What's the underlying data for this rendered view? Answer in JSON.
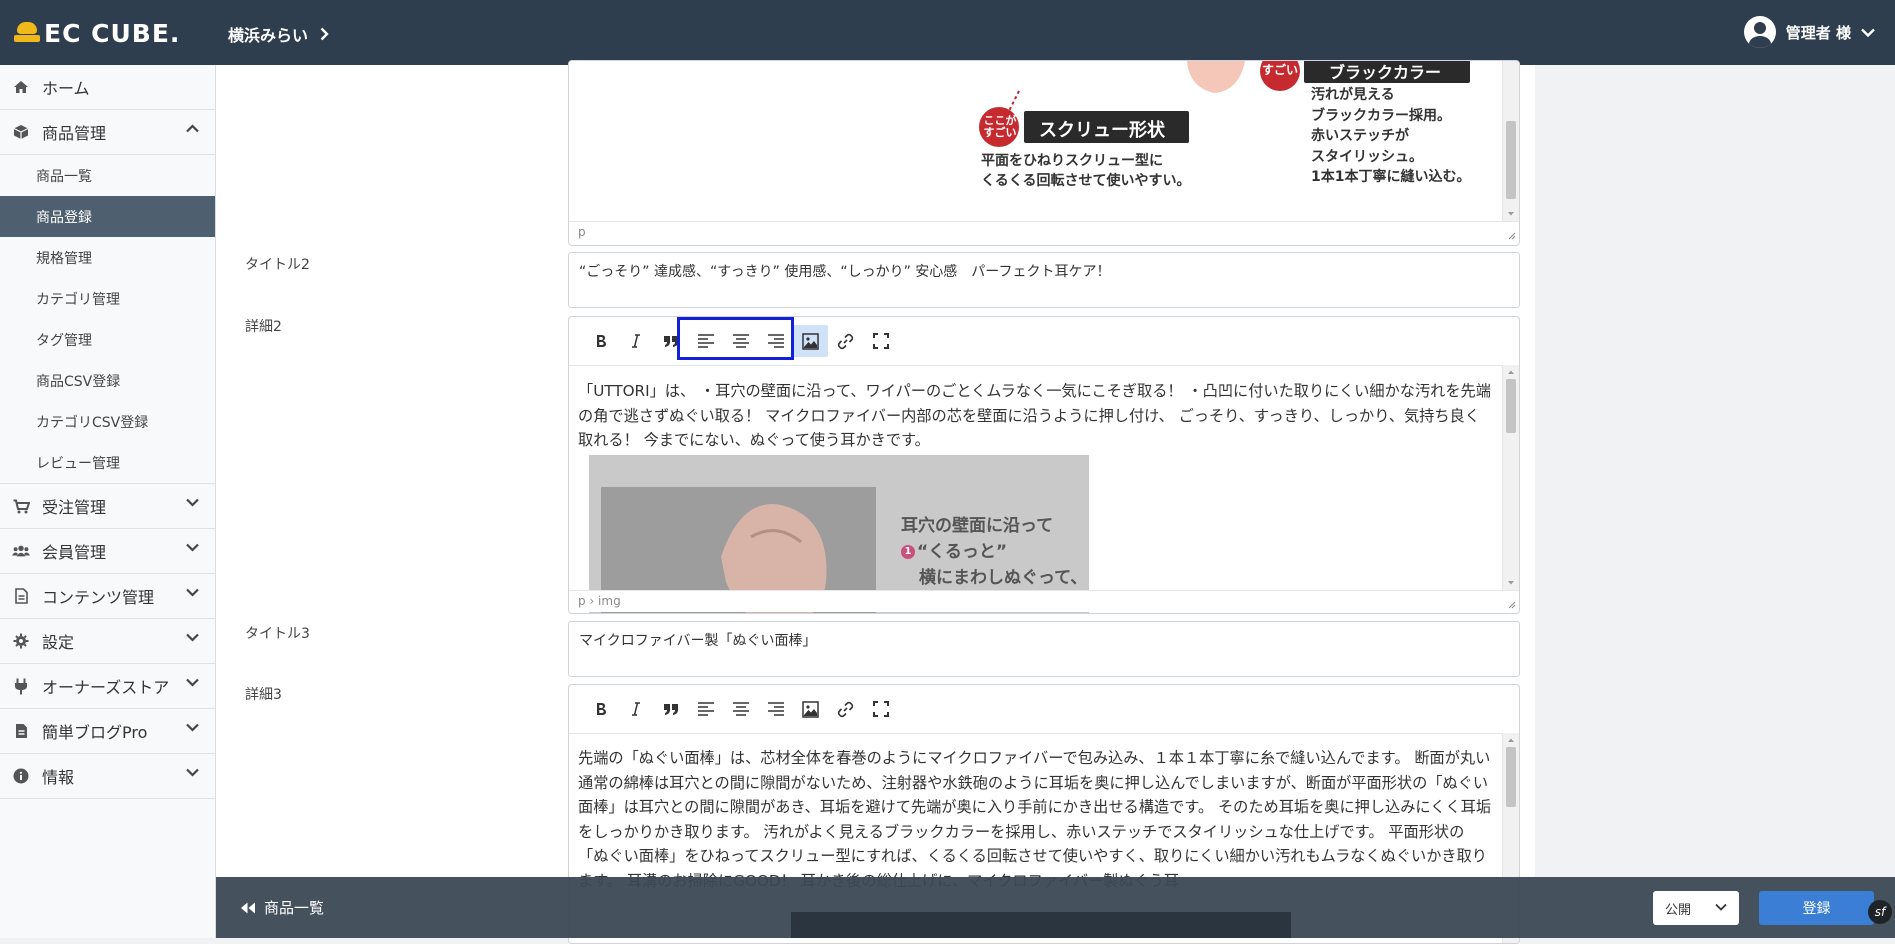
{
  "header": {
    "logo_text": "EC CUBE.",
    "shop_name": "横浜みらい",
    "user_label": "管理者 様"
  },
  "sidebar": {
    "items": [
      {
        "label": "ホーム",
        "icon": "home-icon"
      },
      {
        "label": "商品管理",
        "icon": "box-icon",
        "expanded": true,
        "children": [
          "商品一覧",
          "商品登録",
          "規格管理",
          "カテゴリ管理",
          "タグ管理",
          "商品CSV登録",
          "カテゴリCSV登録",
          "レビュー管理"
        ],
        "active_child": "商品登録"
      },
      {
        "label": "受注管理",
        "icon": "cart-icon"
      },
      {
        "label": "会員管理",
        "icon": "users-icon"
      },
      {
        "label": "コンテンツ管理",
        "icon": "file-icon"
      },
      {
        "label": "設定",
        "icon": "gear-icon"
      },
      {
        "label": "オーナーズストア",
        "icon": "plug-icon"
      },
      {
        "label": "簡単ブログPro",
        "icon": "document-icon"
      },
      {
        "label": "情報",
        "icon": "info-icon"
      }
    ]
  },
  "form": {
    "editor1": {
      "status_path": "p",
      "image_text": {
        "badge": "ここがすごい",
        "screw_title": "スクリュー形状",
        "screw_desc_1": "平面をひねりスクリュー型に",
        "screw_desc_2": "くるくる回転させて使いやすい。",
        "black_title": "ブラックカラー",
        "black_desc": [
          "汚れが見える",
          "ブラックカラー採用。",
          "赤いステッチが",
          "スタイリッシュ。",
          "1本1本丁寧に縫い込む。"
        ],
        "badge2": "すごい"
      }
    },
    "title2": {
      "label": "タイトル2",
      "value": "“ごっそり” 達成感、“すっきり” 使用感、“しっかり” 安心感　パーフェクト耳ケア！"
    },
    "detail2": {
      "label": "詳細2",
      "text": "「UTTORI」は、 ・耳穴の壁面に沿って、ワイパーのごとくムラなく一気にこそぎ取る！ ・凸凹に付いた取りにくい細かな汚れを先端の角で逃さずぬぐい取る！ マイクロファイバー内部の芯を壁面に沿うように押し付け、 ごっそり、すっきり、しっかり、気持ち良く取れる！ 今までにない、ぬぐって使う耳かきです。",
      "image_text_1": "耳穴の壁面に沿って",
      "image_text_2": "“くるっと”",
      "image_text_3": "横にまわしぬぐって、",
      "status_path": "p › img"
    },
    "title3": {
      "label": "タイトル3",
      "value": "マイクロファイバー製「ぬぐい面棒」"
    },
    "detail3": {
      "label": "詳細3",
      "text": "先端の「ぬぐい面棒」は、芯材全体を春巻のようにマイクロファイバーで包み込み、１本１本丁寧に糸で縫い込んでます。 断面が丸い通常の綿棒は耳穴との間に隙間がないため、注射器や水鉄砲のように耳垢を奥に押し込んでしまいますが、断面が平面形状の「ぬぐい面棒」は耳穴との間に隙間があき、耳垢を避けて先端が奥に入り手前にかき出せる構造です。 そのため耳垢を奥に押し込みにくく耳垢をしっかりかき取ります。 汚れがよく見えるブラックカラーを採用し、赤いステッチでスタイリッシュな仕上げです。 平面形状の「ぬぐい面棒」をひねってスクリュー型にすれば、くるくる回転させて使いやすく、取りにくい細かい汚れもムラなくぬぐいかき取ります。 耳溝のお掃除にGOOD！ 耳かき後の総仕上げに、マイクロファイバー製ぬぐう耳"
    }
  },
  "toolbar": [
    "bold",
    "italic",
    "blockquote",
    "align-left",
    "align-center",
    "align-right",
    "image",
    "link",
    "fullscreen"
  ],
  "footer": {
    "back_label": "商品一覧",
    "status_value": "公開",
    "submit_label": "登録"
  },
  "colors": {
    "header_bg": "#2f3e4e",
    "accent": "#3a7fd5",
    "sidebar_active": "#4e5f70"
  }
}
